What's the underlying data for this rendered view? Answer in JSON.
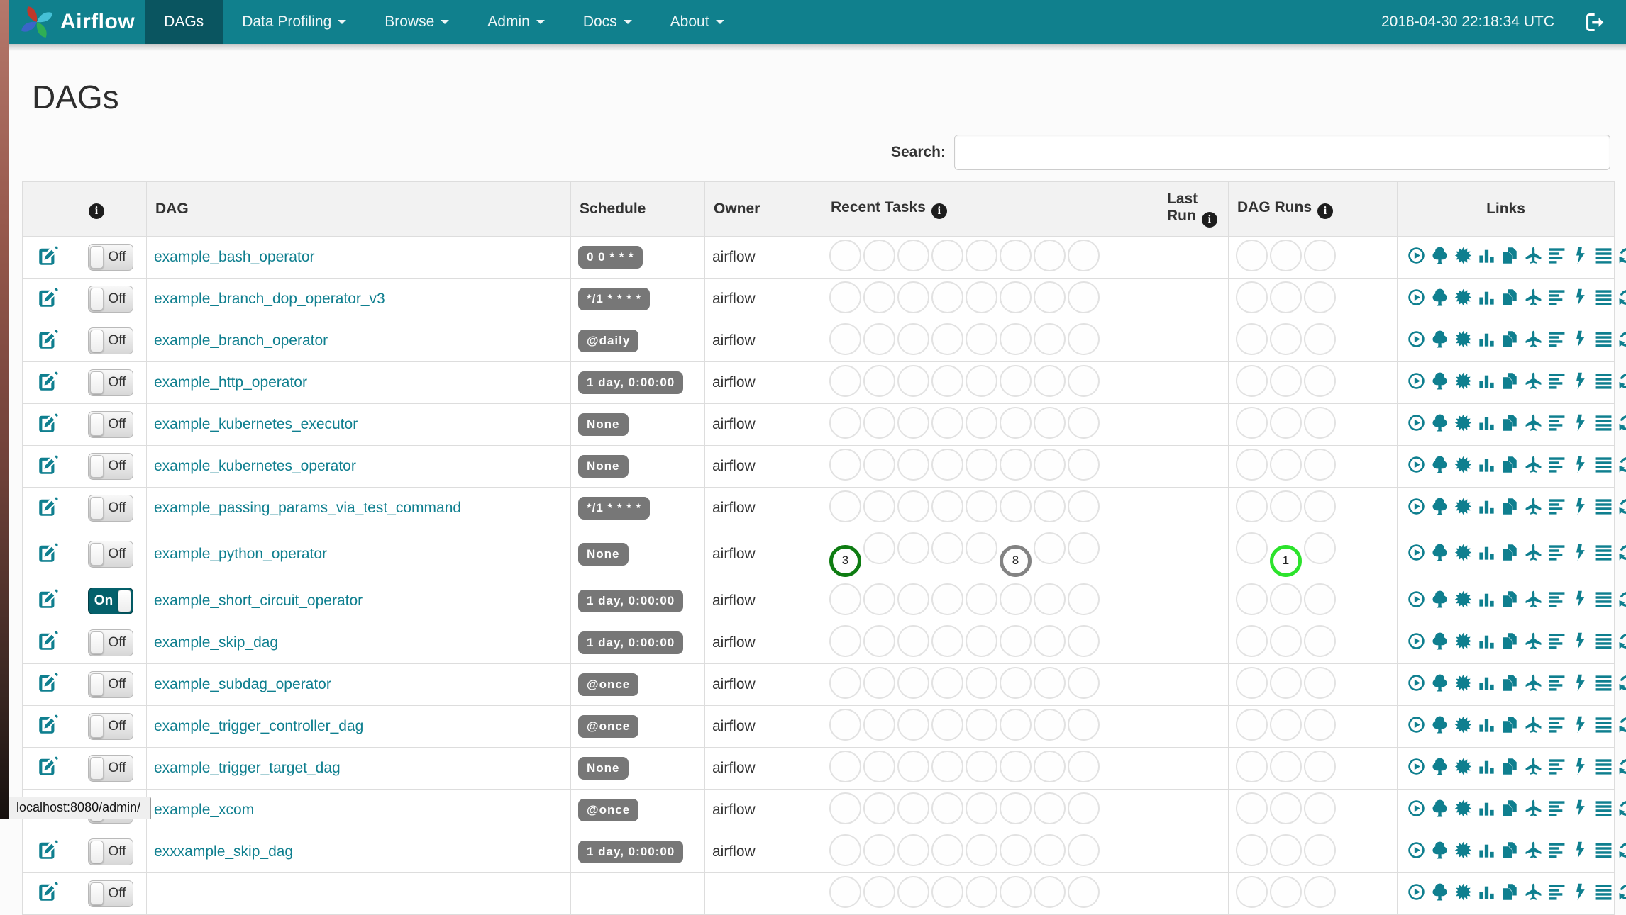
{
  "navbar": {
    "brand": "Airflow",
    "items": [
      {
        "label": "DAGs",
        "active": true,
        "dropdown": false
      },
      {
        "label": "Data Profiling",
        "active": false,
        "dropdown": true
      },
      {
        "label": "Browse",
        "active": false,
        "dropdown": true
      },
      {
        "label": "Admin",
        "active": false,
        "dropdown": true
      },
      {
        "label": "Docs",
        "active": false,
        "dropdown": true
      },
      {
        "label": "About",
        "active": false,
        "dropdown": true
      }
    ],
    "clock": "2018-04-30 22:18:34 UTC"
  },
  "page": {
    "title": "DAGs"
  },
  "search": {
    "label": "Search:",
    "value": ""
  },
  "table": {
    "headers": {
      "dag": "DAG",
      "schedule": "Schedule",
      "owner": "Owner",
      "recent_tasks": "Recent Tasks",
      "last_run": "Last Run",
      "dag_runs": "DAG Runs",
      "links": "Links"
    },
    "recent_tasks_slots": 8,
    "dag_runs_slots": 3,
    "links": [
      {
        "name": "trigger-dag",
        "icon": "play-circle"
      },
      {
        "name": "tree-view",
        "icon": "tree"
      },
      {
        "name": "graph-view",
        "icon": "certificate"
      },
      {
        "name": "task-duration",
        "icon": "stats"
      },
      {
        "name": "task-tries",
        "icon": "duplicate"
      },
      {
        "name": "landing-times",
        "icon": "plane"
      },
      {
        "name": "gantt-view",
        "icon": "align-left"
      },
      {
        "name": "code-view",
        "icon": "flash"
      },
      {
        "name": "dag-details",
        "icon": "align-justify"
      },
      {
        "name": "refresh",
        "icon": "refresh"
      }
    ],
    "rows": [
      {
        "toggle": "Off",
        "dag": "example_bash_operator",
        "schedule": "0 0 * * *",
        "owner": "airflow",
        "recent_tasks": [],
        "dag_runs": []
      },
      {
        "toggle": "Off",
        "dag": "example_branch_dop_operator_v3",
        "schedule": "*/1 * * * *",
        "owner": "airflow",
        "recent_tasks": [],
        "dag_runs": []
      },
      {
        "toggle": "Off",
        "dag": "example_branch_operator",
        "schedule": "@daily",
        "owner": "airflow",
        "recent_tasks": [],
        "dag_runs": []
      },
      {
        "toggle": "Off",
        "dag": "example_http_operator",
        "schedule": "1 day, 0:00:00",
        "owner": "airflow",
        "recent_tasks": [],
        "dag_runs": []
      },
      {
        "toggle": "Off",
        "dag": "example_kubernetes_executor",
        "schedule": "None",
        "owner": "airflow",
        "recent_tasks": [],
        "dag_runs": []
      },
      {
        "toggle": "Off",
        "dag": "example_kubernetes_operator",
        "schedule": "None",
        "owner": "airflow",
        "recent_tasks": [],
        "dag_runs": []
      },
      {
        "toggle": "Off",
        "dag": "example_passing_params_via_test_command",
        "schedule": "*/1 * * * *",
        "owner": "airflow",
        "recent_tasks": [],
        "dag_runs": []
      },
      {
        "toggle": "Off",
        "dag": "example_python_operator",
        "schedule": "None",
        "owner": "airflow",
        "recent_tasks": [
          {
            "slot": 0,
            "count": 3,
            "state": "success"
          },
          {
            "slot": 5,
            "count": 8,
            "state": "queued"
          }
        ],
        "dag_runs": [
          {
            "slot": 1,
            "count": 1,
            "state": "running"
          }
        ]
      },
      {
        "toggle": "On",
        "dag": "example_short_circuit_operator",
        "schedule": "1 day, 0:00:00",
        "owner": "airflow",
        "recent_tasks": [],
        "dag_runs": []
      },
      {
        "toggle": "Off",
        "dag": "example_skip_dag",
        "schedule": "1 day, 0:00:00",
        "owner": "airflow",
        "recent_tasks": [],
        "dag_runs": []
      },
      {
        "toggle": "Off",
        "dag": "example_subdag_operator",
        "schedule": "@once",
        "owner": "airflow",
        "recent_tasks": [],
        "dag_runs": []
      },
      {
        "toggle": "Off",
        "dag": "example_trigger_controller_dag",
        "schedule": "@once",
        "owner": "airflow",
        "recent_tasks": [],
        "dag_runs": []
      },
      {
        "toggle": "Off",
        "dag": "example_trigger_target_dag",
        "schedule": "None",
        "owner": "airflow",
        "recent_tasks": [],
        "dag_runs": []
      },
      {
        "toggle": "Off",
        "dag": "example_xcom",
        "schedule": "@once",
        "owner": "airflow",
        "recent_tasks": [],
        "dag_runs": []
      },
      {
        "toggle": "Off",
        "dag": "exxxample_skip_dag",
        "schedule": "1 day, 0:00:00",
        "owner": "airflow",
        "recent_tasks": [],
        "dag_runs": []
      },
      {
        "toggle": "Off",
        "dag": "",
        "schedule": "",
        "owner": "",
        "recent_tasks": [],
        "dag_runs": [],
        "partial": true
      }
    ]
  },
  "status_bar": {
    "text": "localhost:8080/admin/"
  },
  "colors": {
    "accent_teal": "#0f7f8f",
    "navbar_bg": "#10808d",
    "navbar_active_bg": "#0a5560",
    "toggle_on_bg": "#04606b",
    "badge_bg": "#777777",
    "empty_circle_border": "#e2e2e2",
    "states": {
      "success": "#0e7c12",
      "running": "#2ce32c",
      "queued": "#838383"
    }
  }
}
